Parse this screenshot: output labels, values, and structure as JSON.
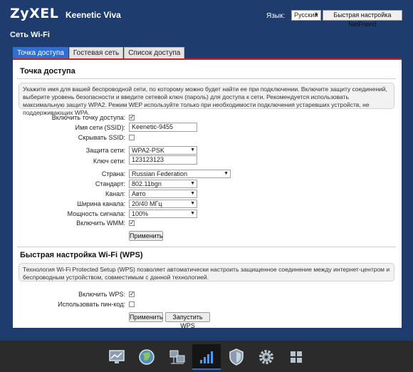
{
  "header": {
    "logo": "ZyXEL",
    "model": "Keenetic Viva",
    "language_label": "Язык:",
    "language_value": "Русский",
    "quick_setup_button": "Быстрая настройка NetFriend"
  },
  "page_title": "Сеть Wi-Fi",
  "tabs": [
    {
      "label": "Точка доступа",
      "active": true
    },
    {
      "label": "Гостевая сеть",
      "active": false
    },
    {
      "label": "Список доступа",
      "active": false
    }
  ],
  "access_point": {
    "title": "Точка доступа",
    "info": "Укажите имя для вашей беспроводной сети, по которому можно будет найти ее при подключении. Включите защиту соединений, выберите уровень безопасности и введите сетевой ключ (пароль) для доступа к сети. Рекомендуется использовать максимальную защиту WPA2. Режим WEP используйте только при необходимости подключения устаревших устройств, не поддерживающих WPA.",
    "fields": {
      "enable_ap": {
        "label": "Включить точку доступа:",
        "checked": true
      },
      "ssid": {
        "label": "Имя сети (SSID):",
        "value": "Keenetic-9455"
      },
      "hide_ssid": {
        "label": "Скрывать SSID:",
        "checked": false
      },
      "security": {
        "label": "Защита сети:",
        "value": "WPA2-PSK"
      },
      "key": {
        "label": "Ключ сети:",
        "value": "123123123"
      },
      "country": {
        "label": "Страна:",
        "value": "Russian Federation"
      },
      "standard": {
        "label": "Стандарт:",
        "value": "802.11bgn"
      },
      "channel": {
        "label": "Канал:",
        "value": "Авто"
      },
      "channel_width": {
        "label": "Ширина канала:",
        "value": "20/40 МГц"
      },
      "power": {
        "label": "Мощность сигнала:",
        "value": "100%"
      },
      "wmm": {
        "label": "Включить WMM:",
        "checked": true
      }
    },
    "apply_button": "Применить"
  },
  "wps": {
    "title": "Быстрая настройка Wi-Fi (WPS)",
    "info": "Технология Wi-Fi Protected Setup (WPS) позволяет автоматически настроить защищенное соединение между интернет-центром и беспроводным устройством, совместимым с данной технологией.",
    "fields": {
      "enable_wps": {
        "label": "Включить WPS:",
        "checked": true
      },
      "use_pin": {
        "label": "Использовать пин-код:",
        "checked": false
      }
    },
    "apply_button": "Применить",
    "start_button": "Запустить WPS"
  },
  "check_mark": "✓",
  "select_arrow": "▼",
  "bottom_nav": [
    {
      "icon": "monitor-chart-icon",
      "active": false
    },
    {
      "icon": "globe-icon",
      "active": false
    },
    {
      "icon": "network-computers-icon",
      "active": false
    },
    {
      "icon": "wifi-signal-bars-icon",
      "active": true
    },
    {
      "icon": "shield-icon",
      "active": false
    },
    {
      "icon": "gear-icon",
      "active": false
    },
    {
      "icon": "apps-grid-icon",
      "active": false
    }
  ],
  "colors": {
    "frame": "#1e3d6e",
    "tab_active": "#2e6fd3",
    "accent_red": "#cc1f1f",
    "bottom_bar": "#2b2b2b"
  }
}
